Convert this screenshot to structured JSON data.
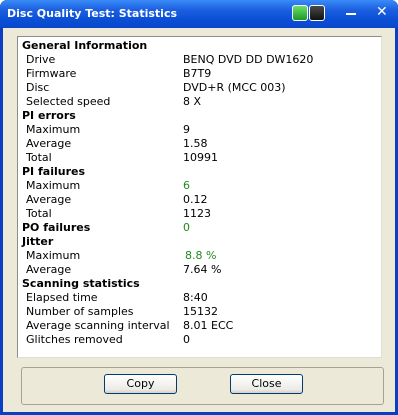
{
  "window": {
    "title": "Disc Quality Test: Statistics"
  },
  "general": {
    "heading": "General Information",
    "drive_label": "Drive",
    "drive_value": "BENQ     DVD DD DW1620",
    "firmware_label": "Firmware",
    "firmware_value": "B7T9",
    "disc_label": "Disc",
    "disc_value": "DVD+R (MCC 003)",
    "speed_label": "Selected speed",
    "speed_value": "8 X"
  },
  "pi_errors": {
    "heading": "PI errors",
    "max_label": "Maximum",
    "max_value": "9",
    "avg_label": "Average",
    "avg_value": "1.58",
    "total_label": "Total",
    "total_value": "10991"
  },
  "pi_failures": {
    "heading": "PI failures",
    "max_label": "Maximum",
    "max_value": "6",
    "avg_label": "Average",
    "avg_value": "0.12",
    "total_label": "Total",
    "total_value": "1123"
  },
  "po_failures": {
    "heading": "PO failures",
    "value": "0"
  },
  "jitter": {
    "heading": "Jitter",
    "max_label": "Maximum",
    "max_value": "8.8 %",
    "avg_label": "Average",
    "avg_value": "7.64 %"
  },
  "scanning": {
    "heading": "Scanning statistics",
    "elapsed_label": "Elapsed time",
    "elapsed_value": "8:40",
    "samples_label": "Number of samples",
    "samples_value": "15132",
    "interval_label": "Average scanning interval",
    "interval_value": "8.01 ECC",
    "glitches_label": "Glitches removed",
    "glitches_value": "0"
  },
  "buttons": {
    "copy": "Copy",
    "close": "Close"
  },
  "colors": {
    "good_value": "#1f8a1f",
    "titlebar": "#0a4fd6"
  }
}
